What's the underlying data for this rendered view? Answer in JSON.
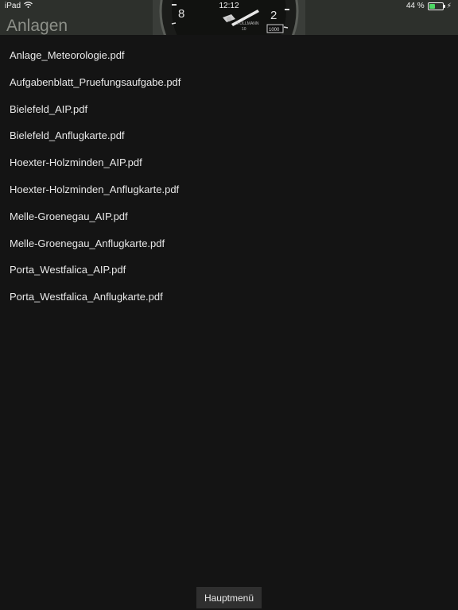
{
  "status_bar": {
    "device": "iPad",
    "time": "12:12",
    "battery": "44 %",
    "battery_level": 0.44,
    "icons": [
      "wifi-icon",
      "battery-icon",
      "charging-bolt-icon"
    ]
  },
  "header": {
    "title": "Anlagen",
    "gauge_numbers": [
      "8",
      "2"
    ],
    "gauge_text": [
      "KOLLMANN",
      "10",
      "1000"
    ]
  },
  "files": [
    "Anlage_Meteorologie.pdf",
    "Aufgabenblatt_Pruefungsaufgabe.pdf",
    "Bielefeld_AIP.pdf",
    "Bielefeld_Anflugkarte.pdf",
    "Hoexter-Holzminden_AIP.pdf",
    "Hoexter-Holzminden_Anflugkarte.pdf",
    "Melle-Groenegau_AIP.pdf",
    "Melle-Groenegau_Anflugkarte.pdf",
    "Porta_Westfalica_AIP.pdf",
    "Porta_Westfalica_Anflugkarte.pdf"
  ],
  "footer": {
    "main_menu_label": "Hauptmenü"
  },
  "colors": {
    "background": "#141414",
    "header": "#2d302c",
    "title": "#8d9089",
    "battery_fill": "#4cd964"
  }
}
